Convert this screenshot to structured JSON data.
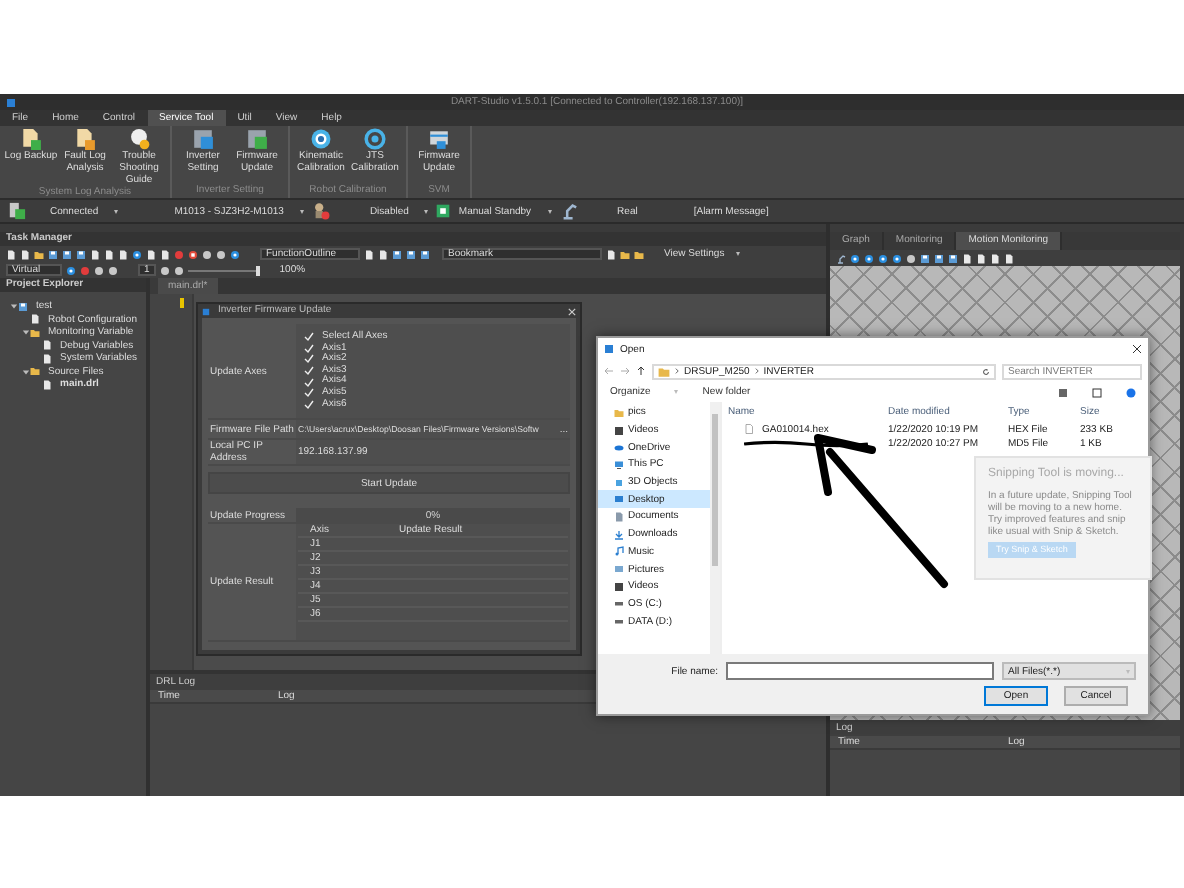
{
  "window": {
    "title": "DART-Studio v1.5.0.1 [Connected to Controller(192.168.137.100)]"
  },
  "menu_tabs": [
    {
      "label": "File",
      "selected": false
    },
    {
      "label": "Home",
      "selected": false
    },
    {
      "label": "Control",
      "selected": false
    },
    {
      "label": "Service Tool",
      "selected": true
    },
    {
      "label": "Util",
      "selected": false
    },
    {
      "label": "View",
      "selected": false
    },
    {
      "label": "Help",
      "selected": false
    }
  ],
  "ribbon_groups": [
    {
      "label": "System Log Analysis",
      "buttons": [
        {
          "label": "Log Backup"
        },
        {
          "label": "Fault Log Analysis"
        },
        {
          "label": "Trouble Shooting Guide"
        }
      ]
    },
    {
      "label": "Inverter Setting",
      "buttons": [
        {
          "label": "Inverter Setting"
        },
        {
          "label": "Firmware Update"
        }
      ]
    },
    {
      "label": "Robot Calibration",
      "buttons": [
        {
          "label": "Kinematic Calibration"
        },
        {
          "label": "JTS Calibration"
        }
      ]
    },
    {
      "label": "SVM",
      "buttons": [
        {
          "label": "Firmware Update"
        }
      ]
    }
  ],
  "status_toolbar": {
    "connection": "Connected",
    "robot": "M1013 - SJZ3H2-M1013",
    "servo": "Disabled",
    "mode": "Manual Standby",
    "real": "Real",
    "alarm": "[Alarm Message]"
  },
  "task_manager": {
    "title": "Task Manager",
    "function_outline": "FunctionOutline",
    "bookmark": "Bookmark",
    "view_settings": "View Settings",
    "sim_mode": "Virtual",
    "step": "1",
    "speed": {
      "level": 1,
      "reading": "100%"
    }
  },
  "project_explorer": {
    "title": "Project Explorer",
    "tree": [
      {
        "label": "test",
        "expanded": true,
        "children": [
          {
            "label": "Robot Configuration"
          },
          {
            "label": "Monitoring Variable",
            "expanded": true,
            "children": [
              {
                "label": "Debug Variables"
              },
              {
                "label": "System Variables"
              }
            ]
          },
          {
            "label": "Source Files",
            "expanded": true,
            "children": [
              {
                "label": "main.drl",
                "active": true
              }
            ]
          }
        ]
      }
    ]
  },
  "editor_tab": "main.drl*",
  "firmware_dialog": {
    "title": "Inverter Firmware Update",
    "axes_label": "Update Axes",
    "axes": [
      {
        "label": "Select All Axes",
        "checked": true
      },
      {
        "label": "Axis1",
        "checked": true
      },
      {
        "label": "Axis2",
        "checked": true
      },
      {
        "label": "Axis3",
        "checked": true
      },
      {
        "label": "Axis4",
        "checked": true
      },
      {
        "label": "Axis5",
        "checked": true
      },
      {
        "label": "Axis6",
        "checked": true
      }
    ],
    "path_label": "Firmware File Path",
    "path": "C:\\Users\\acrux\\Desktop\\Doosan Files\\Firmware Versions\\Softw",
    "browse": "...",
    "ip_label": "Local PC IP Address",
    "ip": "192.168.137.99",
    "start": "Start Update",
    "progress_label": "Update Progress",
    "progress": {
      "level": 0,
      "reading": "0%"
    },
    "result_label": "Update Result",
    "result_columns": [
      "Axis",
      "Update Result"
    ],
    "result_rows": [
      {
        "axis": "J1"
      },
      {
        "axis": "J2"
      },
      {
        "axis": "J3"
      },
      {
        "axis": "J4"
      },
      {
        "axis": "J5"
      },
      {
        "axis": "J6"
      }
    ]
  },
  "drl_log": {
    "title": "DRL Log",
    "columns": [
      "Time",
      "Log"
    ]
  },
  "right_tabs": [
    {
      "label": "Graph",
      "selected": false
    },
    {
      "label": "Monitoring",
      "selected": false
    },
    {
      "label": "Motion Monitoring",
      "selected": true
    }
  ],
  "right_log": {
    "title": "Log",
    "columns": [
      "Time",
      "Log"
    ]
  },
  "open_dialog": {
    "title": "Open",
    "path": [
      "DRSUP_M250",
      "INVERTER"
    ],
    "search_placeholder": "Search INVERTER",
    "organize": "Organize",
    "new_folder": "New folder",
    "nav": [
      {
        "label": "pics",
        "kind": "folder",
        "selected": false
      },
      {
        "label": "Videos",
        "kind": "video",
        "selected": false
      },
      {
        "label": "OneDrive",
        "kind": "cloud",
        "selected": false
      },
      {
        "label": "This PC",
        "kind": "pc",
        "selected": false
      },
      {
        "label": "3D Objects",
        "kind": "cube",
        "selected": false
      },
      {
        "label": "Desktop",
        "kind": "desktop",
        "selected": true
      },
      {
        "label": "Documents",
        "kind": "docs",
        "selected": false
      },
      {
        "label": "Downloads",
        "kind": "download",
        "selected": false
      },
      {
        "label": "Music",
        "kind": "music",
        "selected": false
      },
      {
        "label": "Pictures",
        "kind": "pictures",
        "selected": false
      },
      {
        "label": "Videos",
        "kind": "video",
        "selected": false
      },
      {
        "label": "OS (C:)",
        "kind": "drive",
        "selected": false
      },
      {
        "label": "DATA (D:)",
        "kind": "drive",
        "selected": false
      }
    ],
    "columns": [
      "Name",
      "Date modified",
      "Type",
      "Size"
    ],
    "files": [
      {
        "name": "GA010014.hex",
        "redacted": false,
        "date": "1/22/2020 10:19 PM",
        "type": "HEX File",
        "size": "233 KB"
      },
      {
        "redacted": true,
        "date": "1/22/2020 10:27 PM",
        "type": "MD5 File",
        "size": "1 KB"
      }
    ],
    "file_name_label": "File name:",
    "filter": "All Files(*.*)",
    "open": "Open",
    "cancel": "Cancel"
  },
  "notification": {
    "title": "Snipping Tool is moving...",
    "body": "In a future update, Snipping Tool will be moving to a new home. Try improved features and snip like usual with Snip & Sketch.",
    "button": "Try Snip & Sketch"
  }
}
